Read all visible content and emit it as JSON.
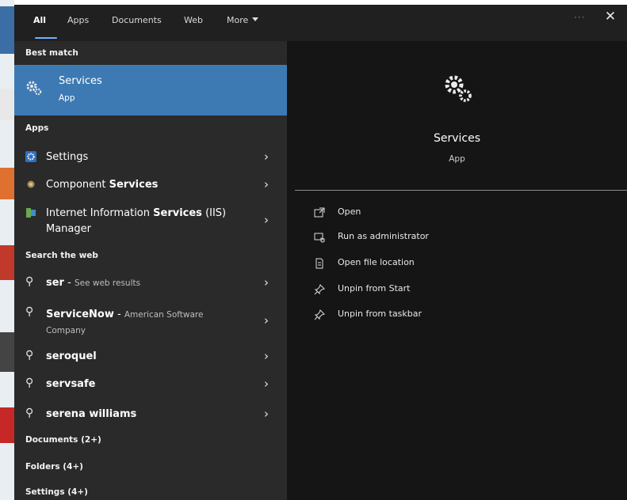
{
  "tabs": [
    "All",
    "Apps",
    "Documents",
    "Web",
    "More"
  ],
  "window_controls": {
    "dots": "···",
    "close": "✕"
  },
  "sections": {
    "best_match": "Best match",
    "apps": "Apps",
    "search_web": "Search the web",
    "documents": "Documents (2+)",
    "folders": "Folders (4+)",
    "settings": "Settings (4+)"
  },
  "best_match": {
    "name": "Services",
    "type": "App"
  },
  "apps": [
    {
      "pre": "",
      "bold": "",
      "post": "Settings",
      "icon": "settings-gear-icon"
    },
    {
      "pre": "Component ",
      "bold": "Services",
      "post": "",
      "icon": "component-services-icon"
    },
    {
      "pre": "Internet Information ",
      "bold": "Services",
      "post": " (IIS)",
      "line2": "Manager",
      "icon": "iis-manager-icon"
    }
  ],
  "web": [
    {
      "bold": "ser",
      "rest": " - ",
      "sub": "See web results"
    },
    {
      "bold": "ServiceNow",
      "rest": " - ",
      "sub": "American Software",
      "sub2": "Company"
    },
    {
      "bold": "seroquel"
    },
    {
      "bold": "servsafe"
    },
    {
      "bold": "serena williams"
    }
  ],
  "detail": {
    "title": "Services",
    "subtitle": "App"
  },
  "actions": [
    {
      "label": "Open",
      "icon": "open-icon"
    },
    {
      "label": "Run as administrator",
      "icon": "shield-admin-icon"
    },
    {
      "label": "Open file location",
      "icon": "file-location-icon"
    },
    {
      "label": "Unpin from Start",
      "icon": "unpin-icon"
    },
    {
      "label": "Unpin from taskbar",
      "icon": "unpin-icon"
    }
  ],
  "colors": {
    "accent": "#3d7ab3",
    "tab_underline": "#6fb1ff",
    "left_bg": "#2a2a2a",
    "right_bg": "#151515"
  }
}
